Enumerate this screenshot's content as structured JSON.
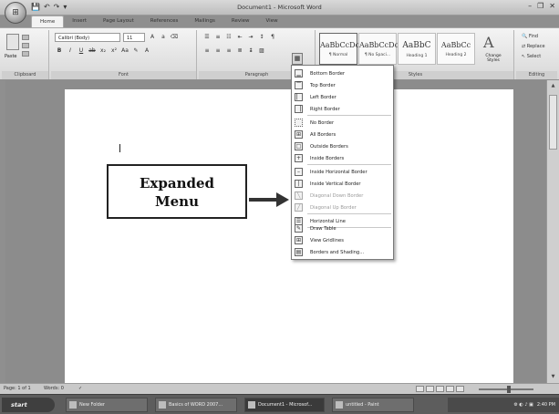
{
  "window": {
    "title": "Document1 - Microsoft Word",
    "quick_access": [
      "💾",
      "↶",
      "↷",
      "▾"
    ],
    "controls": [
      "–",
      "❐",
      "✕"
    ]
  },
  "tabs": [
    {
      "label": "Home",
      "active": true
    },
    {
      "label": "Insert",
      "active": false
    },
    {
      "label": "Page Layout",
      "active": false
    },
    {
      "label": "References",
      "active": false
    },
    {
      "label": "Mailings",
      "active": false
    },
    {
      "label": "Review",
      "active": false
    },
    {
      "label": "View",
      "active": false
    }
  ],
  "ribbon": {
    "clipboard": {
      "paste_label": "Paste",
      "group_label": "Clipboard"
    },
    "font": {
      "font_name": "Calibri (Body)",
      "font_size": "11",
      "group_label": "Font"
    },
    "paragraph": {
      "group_label": "Paragraph"
    },
    "styles": {
      "group_label": "Styles",
      "items": [
        {
          "sample": "AaBbCcDc",
          "name": "¶ Normal"
        },
        {
          "sample": "AaBbCcDc",
          "name": "¶ No Spaci..."
        },
        {
          "sample": "AaBbC",
          "name": "Heading 1"
        },
        {
          "sample": "AaBbCc",
          "name": "Heading 2"
        }
      ],
      "change_label": "Change Styles"
    },
    "editing": {
      "group_label": "Editing",
      "find": "Find",
      "replace": "Replace",
      "select": "Select"
    }
  },
  "document": {
    "label_line1": "Expanded",
    "label_line2": "Menu"
  },
  "border_menu": {
    "button_glyph": "▦",
    "items": [
      {
        "label": "Bottom Border",
        "icon": "▁",
        "disabled": false
      },
      {
        "label": "Top Border",
        "icon": "▔",
        "disabled": false
      },
      {
        "label": "Left Border",
        "icon": "▏",
        "disabled": false
      },
      {
        "label": "Right Border",
        "icon": "▕",
        "disabled": false
      },
      {
        "label": "No Border",
        "icon": "",
        "disabled": false
      },
      {
        "label": "All Borders",
        "icon": "⊞",
        "disabled": false
      },
      {
        "label": "Outside Borders",
        "icon": "□",
        "disabled": false
      },
      {
        "label": "Inside Borders",
        "icon": "+",
        "disabled": false
      },
      {
        "label": "Inside Horizontal Border",
        "icon": "–",
        "disabled": false
      },
      {
        "label": "Inside Vertical Border",
        "icon": "|",
        "disabled": false
      },
      {
        "label": "Diagonal Down Border",
        "icon": "╲",
        "disabled": true
      },
      {
        "label": "Diagonal Up Border",
        "icon": "╱",
        "disabled": true
      },
      {
        "label": "Horizontal Line",
        "icon": "☰",
        "disabled": false
      },
      {
        "label": "Draw Table",
        "icon": "✎",
        "disabled": false
      },
      {
        "label": "View Gridlines",
        "icon": "⊞",
        "disabled": false
      },
      {
        "label": "Borders and Shading...",
        "icon": "▤",
        "disabled": false
      }
    ]
  },
  "status": {
    "page": "Page: 1 of 1",
    "words": "Words: 0"
  },
  "taskbar": {
    "start": "start",
    "buttons": [
      {
        "label": "New Folder",
        "active": false
      },
      {
        "label": "Basics of WORD 2007...",
        "active": false
      },
      {
        "label": "Document1 - Microsof...",
        "active": true
      },
      {
        "label": "untitled - Paint",
        "active": false
      }
    ],
    "clock": "2:40 PM"
  }
}
